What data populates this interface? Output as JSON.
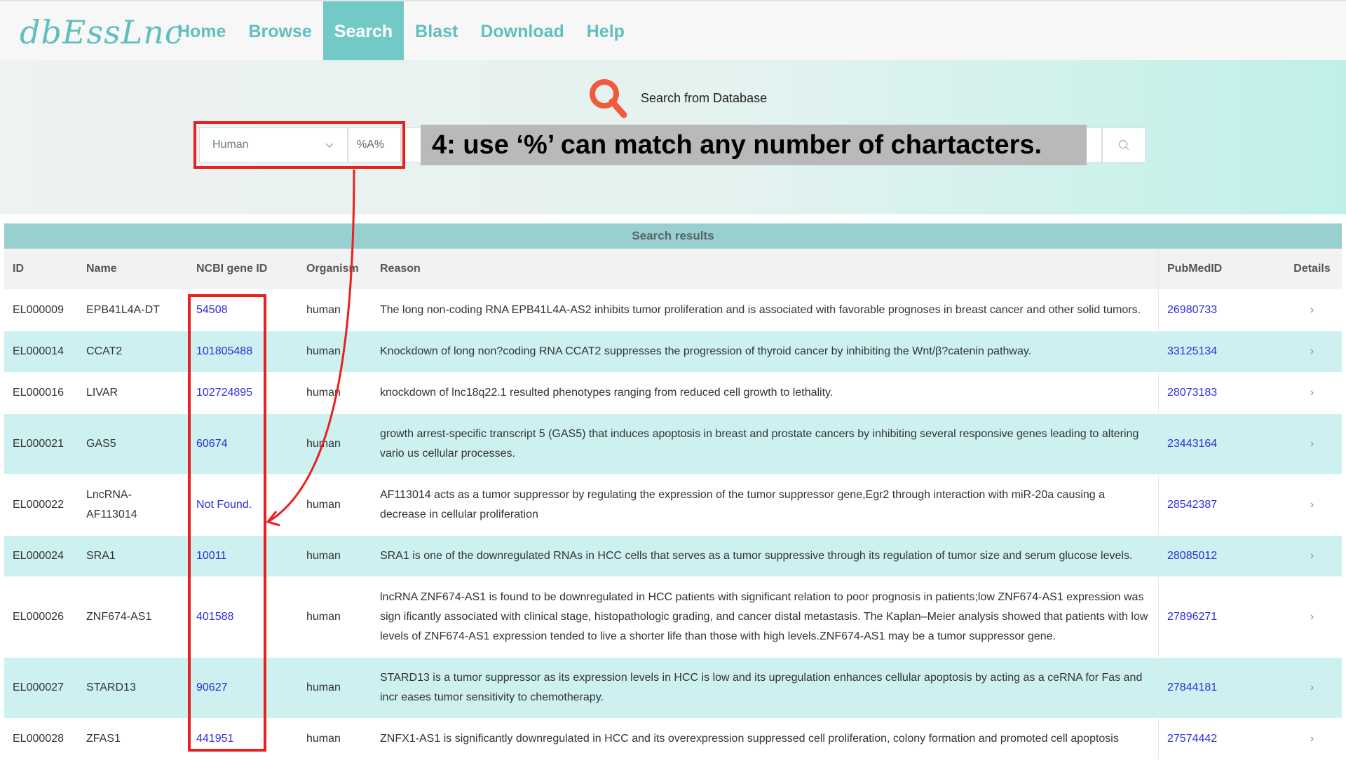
{
  "nav": {
    "logo": "dbEssLnc",
    "items": [
      {
        "label": "Home",
        "active": false
      },
      {
        "label": "Browse",
        "active": false
      },
      {
        "label": "Search",
        "active": true
      },
      {
        "label": "Blast",
        "active": false
      },
      {
        "label": "Download",
        "active": false
      },
      {
        "label": "Help",
        "active": false
      }
    ]
  },
  "search": {
    "title": "Search from Database",
    "organism": "Human",
    "query": "%A%",
    "annotation": "4: use  ‘%’  can match any number of chartacters.",
    "icons": {
      "title": "magnifier-icon",
      "button": "search-icon"
    }
  },
  "results": {
    "title": "Search results",
    "columns": [
      "ID",
      "Name",
      "NCBI gene ID",
      "Organism",
      "Reason",
      "PubMedID",
      "Details"
    ],
    "rows": [
      {
        "id": "EL000009",
        "name": "EPB41L4A-DT",
        "ncbi": "54508",
        "organism": "human",
        "reason": "The long non-coding RNA EPB41L4A-AS2 inhibits tumor proliferation and is associated with favorable prognoses in breast cancer and other solid tumors.",
        "pubmed": "26980733"
      },
      {
        "id": "EL000014",
        "name": "CCAT2",
        "ncbi": "101805488",
        "organism": "human",
        "reason": "Knockdown of long non?coding RNA CCAT2 suppresses the progression of thyroid cancer by inhibiting the Wnt/β?catenin pathway.",
        "pubmed": "33125134"
      },
      {
        "id": "EL000016",
        "name": "LIVAR",
        "ncbi": "102724895",
        "organism": "human",
        "reason": "knockdown of lnc18q22.1 resulted phenotypes ranging from reduced cell growth to lethality.",
        "pubmed": "28073183"
      },
      {
        "id": "EL000021",
        "name": "GAS5",
        "ncbi": "60674",
        "organism": "human",
        "reason": "growth arrest-specific transcript 5 (GAS5) that induces apoptosis in breast and prostate cancers by inhibiting several responsive genes leading to altering vario us cellular processes.",
        "pubmed": "23443164"
      },
      {
        "id": "EL000022",
        "name": "LncRNA-AF113014",
        "ncbi": "Not Found.",
        "organism": "human",
        "reason": "AF113014 acts as a tumor suppressor by regulating the expression of the tumor suppressor gene,Egr2 through interaction with miR-20a causing a decrease in cellular proliferation",
        "pubmed": "28542387"
      },
      {
        "id": "EL000024",
        "name": "SRA1",
        "ncbi": "10011",
        "organism": "human",
        "reason": "SRA1 is one of the downregulated RNAs in HCC cells that serves as a tumor suppressive through its regulation of tumor size and serum glucose levels.",
        "pubmed": "28085012"
      },
      {
        "id": "EL000026",
        "name": "ZNF674-AS1",
        "ncbi": "401588",
        "organism": "human",
        "reason": "lncRNA ZNF674-AS1 is found to be downregulated in HCC patients with significant relation to poor prognosis in patients;low ZNF674-AS1 expression was sign ificantly associated with clinical stage, histopathologic grading, and cancer distal metastasis. The Kaplan–Meier analysis showed that patients with low levels of ZNF674-AS1 expression tended to live a shorter life than those with high levels.ZNF674-AS1 may be a tumor suppressor gene.",
        "pubmed": "27896271"
      },
      {
        "id": "EL000027",
        "name": "STARD13",
        "ncbi": "90627",
        "organism": "human",
        "reason": "STARD13 is a tumor suppressor as its expression levels in HCC is low and its upregulation enhances cellular apoptosis by acting as a ceRNA for Fas and incr eases tumor sensitivity to chemotherapy.",
        "pubmed": "27844181"
      },
      {
        "id": "EL000028",
        "name": "ZFAS1",
        "ncbi": "441951",
        "organism": "human",
        "reason": "ZNFX1-AS1 is significantly downregulated in HCC and its overexpression suppressed cell proliferation, colony formation and promoted cell apoptosis",
        "pubmed": "27574442"
      }
    ],
    "details_glyph": "›"
  },
  "colors": {
    "accent": "#5fbfbf",
    "active_nav": "#72c9c5",
    "highlight_red": "#e8201f",
    "link": "#2d2ddc",
    "row_alt": "#cdf1f0"
  }
}
